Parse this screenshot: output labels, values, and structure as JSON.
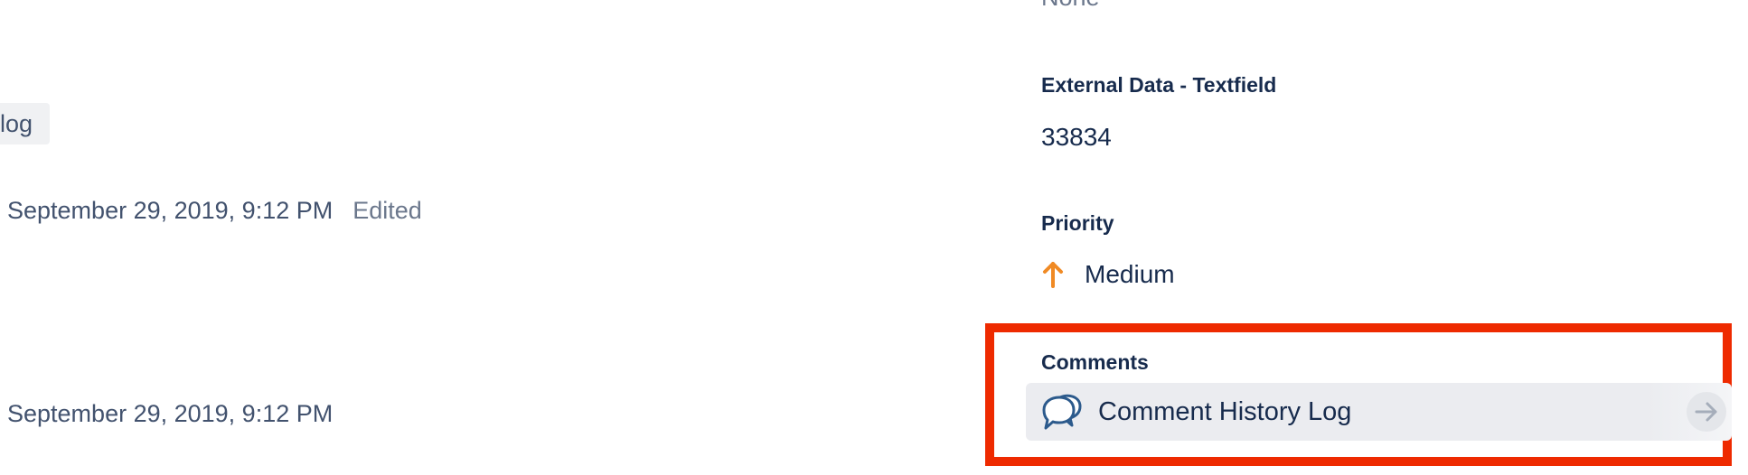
{
  "activity": {
    "tag_chip_label": "log",
    "entries": [
      {
        "timestamp": "September 29, 2019, 9:12 PM",
        "status": "Edited"
      },
      {
        "timestamp": "September 29, 2019, 9:12 PM"
      }
    ]
  },
  "details": {
    "previous_value": "None",
    "external_data": {
      "label": "External Data - Textfield",
      "value": "33834"
    },
    "priority": {
      "label": "Priority",
      "value": "Medium",
      "icon": "arrow-up-icon",
      "icon_color": "#f08a24"
    },
    "comments": {
      "label": "Comments",
      "link_label": "Comment History Log",
      "link_icon": "comment-bubbles-icon",
      "action_icon": "arrow-right-icon"
    }
  },
  "highlight": {
    "color": "#ee2a00"
  }
}
